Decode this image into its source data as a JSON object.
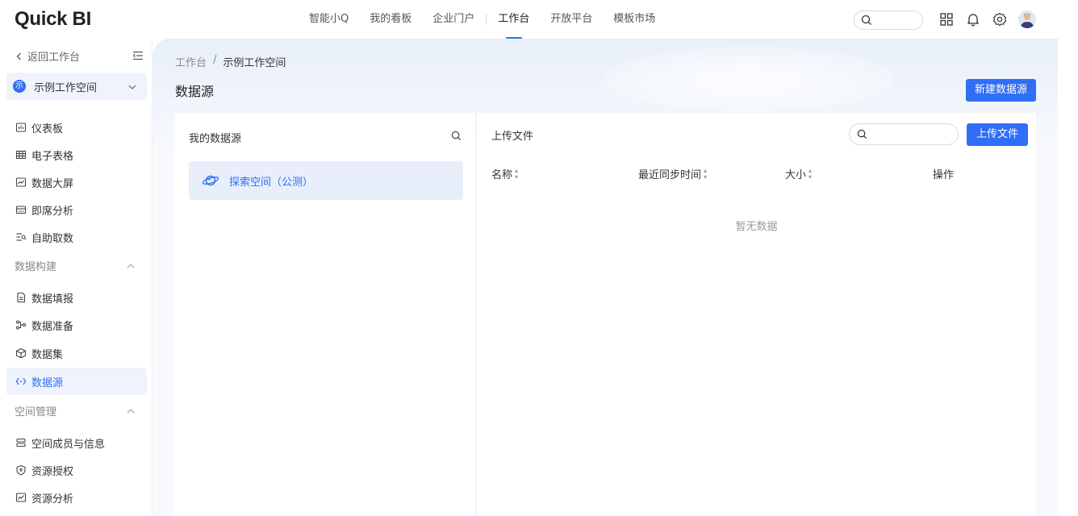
{
  "header": {
    "logo": "Quick BI",
    "nav": [
      {
        "label": "智能小Q"
      },
      {
        "label": "我的看板"
      },
      {
        "label": "企业门户"
      },
      {
        "label": "工作台"
      },
      {
        "label": "开放平台"
      },
      {
        "label": "模板市场"
      }
    ],
    "active_nav": "工作台",
    "search_placeholder": ""
  },
  "sidebar": {
    "back_label": "返回工作台",
    "workspace_badge": "示",
    "workspace_name": "示例工作空间",
    "items_top": [
      {
        "label": "仪表板",
        "icon": "dashboard-icon"
      },
      {
        "label": "电子表格",
        "icon": "spreadsheet-icon"
      },
      {
        "label": "数据大屏",
        "icon": "big-screen-icon"
      },
      {
        "label": "即席分析",
        "icon": "adhoc-analysis-icon"
      },
      {
        "label": "自助取数",
        "icon": "self-service-data-icon"
      }
    ],
    "group_build": "数据构建",
    "items_build": [
      {
        "label": "数据填报",
        "icon": "data-entry-icon"
      },
      {
        "label": "数据准备",
        "icon": "data-prep-icon"
      },
      {
        "label": "数据集",
        "icon": "dataset-icon"
      },
      {
        "label": "数据源",
        "icon": "datasource-icon"
      }
    ],
    "group_space": "空间管理",
    "items_space": [
      {
        "label": "空间成员与信息",
        "icon": "members-icon"
      },
      {
        "label": "资源授权",
        "icon": "shield-icon"
      },
      {
        "label": "资源分析",
        "icon": "resource-analysis-icon"
      }
    ],
    "active_item": "数据源"
  },
  "main": {
    "breadcrumb": [
      "工作台",
      "示例工作空间"
    ],
    "breadcrumb_sep": "/",
    "title": "数据源",
    "new_button": "新建数据源",
    "left_panel": {
      "title": "我的数据源",
      "items": [
        {
          "label": "探索空间（公测）"
        }
      ]
    },
    "right_panel": {
      "title": "上传文件",
      "upload_button": "上传文件",
      "columns": [
        "名称",
        "最近同步时间",
        "大小",
        "操作"
      ],
      "empty_text": "暂无数据"
    }
  },
  "colors": {
    "accent": "#2f6ef6",
    "active_bg": "#eef3fc"
  }
}
